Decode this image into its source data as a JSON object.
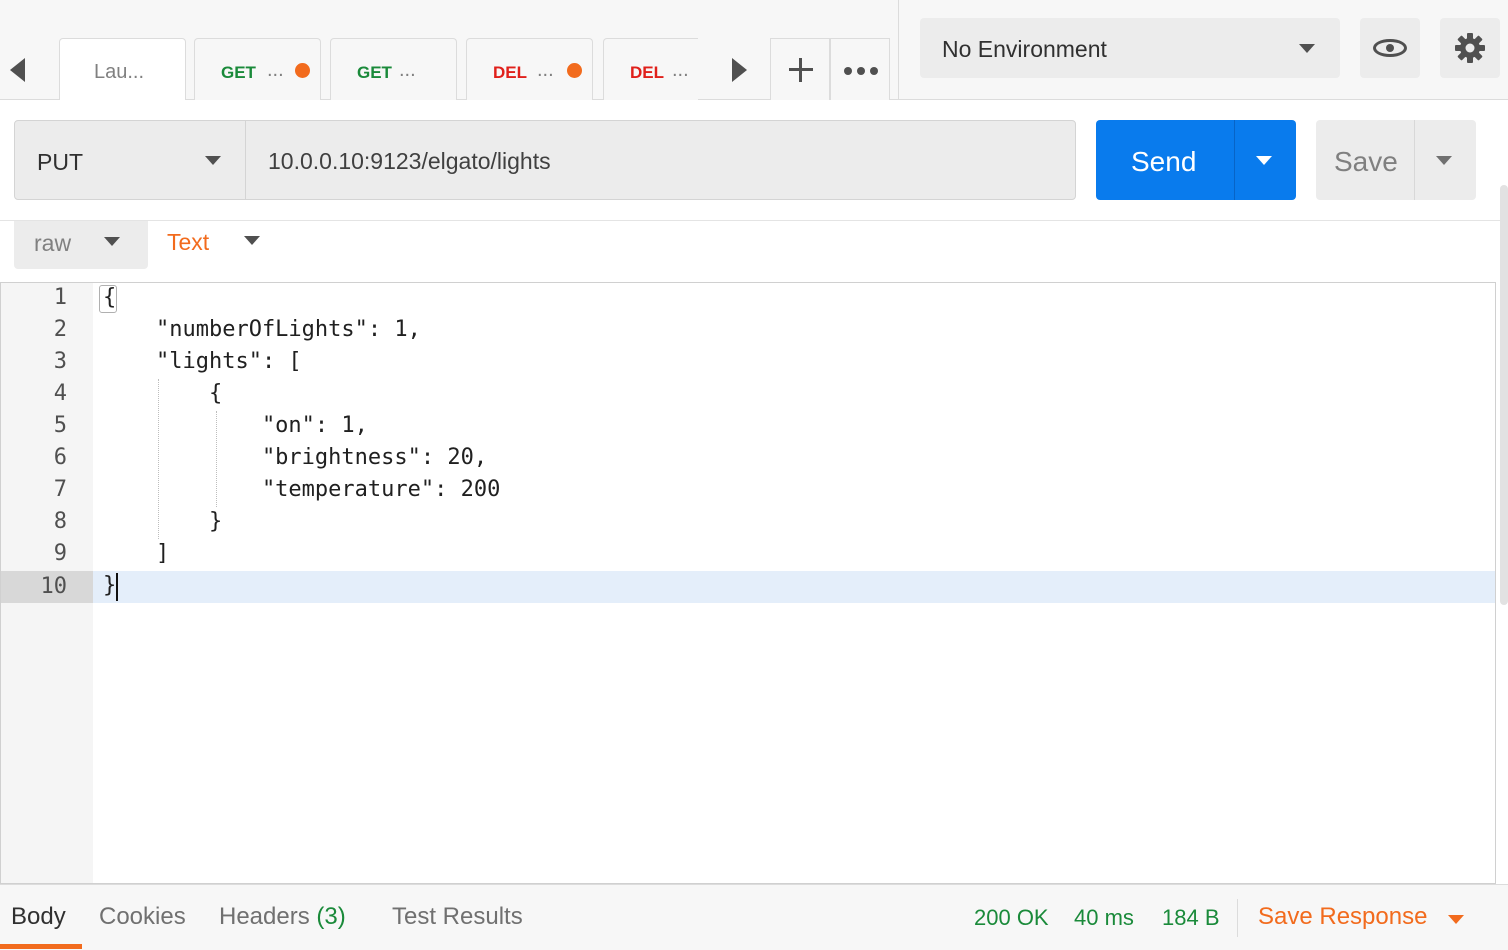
{
  "tabs": [
    {
      "label": "Lau..."
    },
    {
      "method": "GET",
      "ellipsis": "...",
      "unsaved": true
    },
    {
      "method": "GET",
      "ellipsis": "...",
      "unsaved": false
    },
    {
      "method": "DEL",
      "ellipsis": "...",
      "unsaved": true
    },
    {
      "method": "DEL",
      "ellipsis": "...",
      "unsaved": false
    }
  ],
  "environment": {
    "selected": "No Environment"
  },
  "request": {
    "method": "PUT",
    "url": "10.0.0.10:9123/elgato/lights",
    "send_label": "Send",
    "save_label": "Save"
  },
  "body": {
    "mode": "raw",
    "content_type": "Text",
    "lines": [
      {
        "num": "1",
        "code": "{"
      },
      {
        "num": "2",
        "code": "    \"numberOfLights\": 1,"
      },
      {
        "num": "3",
        "code": "    \"lights\": ["
      },
      {
        "num": "4",
        "code": "        {"
      },
      {
        "num": "5",
        "code": "            \"on\": 1,"
      },
      {
        "num": "6",
        "code": "            \"brightness\": 20,"
      },
      {
        "num": "7",
        "code": "            \"temperature\": 200"
      },
      {
        "num": "8",
        "code": "        }"
      },
      {
        "num": "9",
        "code": "    ]"
      },
      {
        "num": "10",
        "code": "}"
      }
    ],
    "active_line": 10
  },
  "response": {
    "tabs": {
      "body": "Body",
      "cookies": "Cookies",
      "headers": "Headers",
      "headers_count": "(3)",
      "tests": "Test Results"
    },
    "status": "200 OK",
    "time": "40 ms",
    "size": "184 B",
    "save_label": "Save Response"
  },
  "colors": {
    "accent_orange": "#f26b1d",
    "send_blue": "#097bed",
    "get_green": "#1a8a3a",
    "del_red": "#e0201b"
  }
}
